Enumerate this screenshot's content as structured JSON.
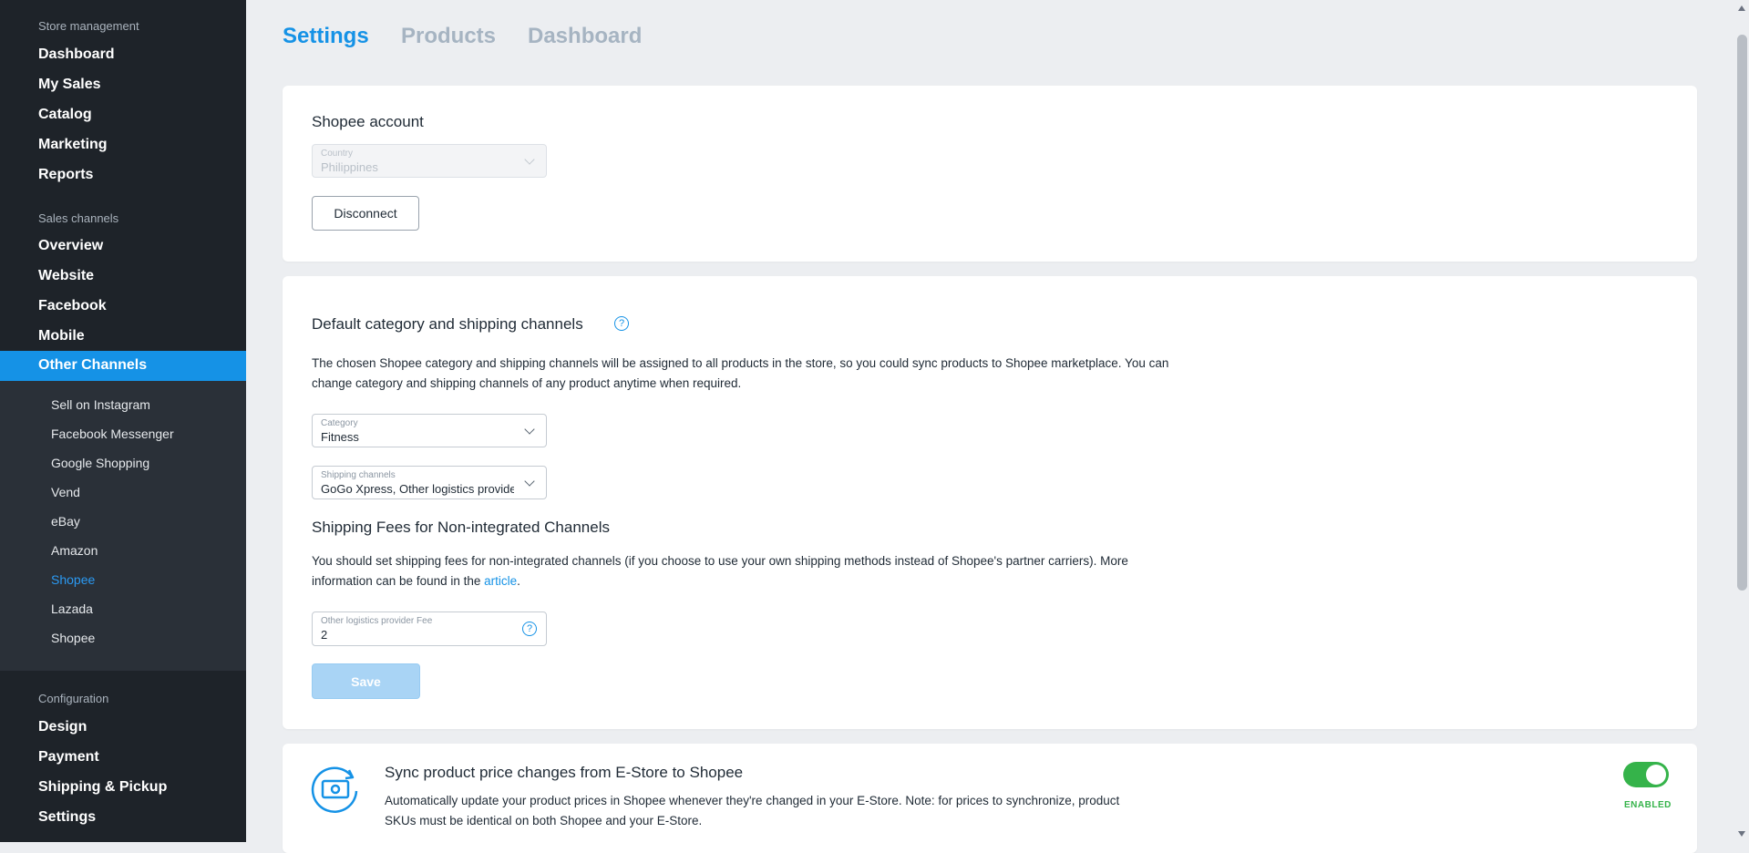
{
  "sidebar": {
    "store_section": "Store management",
    "store_items": [
      "Dashboard",
      "My Sales",
      "Catalog",
      "Marketing",
      "Reports"
    ],
    "sales_section": "Sales channels",
    "sales_items": [
      "Overview",
      "Website",
      "Facebook",
      "Mobile"
    ],
    "active_item": "Other Channels",
    "sub_items": [
      "Sell on Instagram",
      "Facebook Messenger",
      "Google Shopping",
      "Vend",
      "eBay",
      "Amazon",
      "Shopee",
      "Lazada",
      "Shopee"
    ],
    "config_section": "Configuration",
    "config_items": [
      "Design",
      "Payment",
      "Shipping & Pickup",
      "Settings"
    ]
  },
  "tabs": [
    "Settings",
    "Products",
    "Dashboard"
  ],
  "account": {
    "title": "Shopee account",
    "country_label": "Country",
    "country_value": "Philippines",
    "disconnect_label": "Disconnect"
  },
  "defaults": {
    "title": "Default category and shipping channels",
    "description": "The chosen Shopee category and shipping channels will be assigned to all products in the store, so you could sync products to Shopee marketplace. You can change category and shipping channels of any product anytime when required.",
    "category_label": "Category",
    "category_value": "Fitness",
    "shipping_label": "Shipping channels",
    "shipping_value": "GoGo Xpress, Other logistics provider",
    "fees_title": "Shipping Fees for Non-integrated Channels",
    "fees_description_prefix": "You should set shipping fees for non-integrated channels (if you choose to use your own shipping methods instead of Shopee's partner carriers). More information can be found in the ",
    "fees_link": "article",
    "fees_description_suffix": ".",
    "fee_label": "Other logistics provider Fee",
    "fee_value": "2",
    "save_label": "Save"
  },
  "sync": {
    "title": "Sync product price changes from E-Store to Shopee",
    "description": "Automatically update your product prices in Shopee whenever they're changed in your E-Store. Note: for prices to synchronize, product SKUs must be identical on both Shopee and your E-Store.",
    "status": "ENABLED"
  },
  "colors": {
    "accent": "#1592e6",
    "sidebar_bg": "#1e2329",
    "enabled": "#35b34a"
  }
}
